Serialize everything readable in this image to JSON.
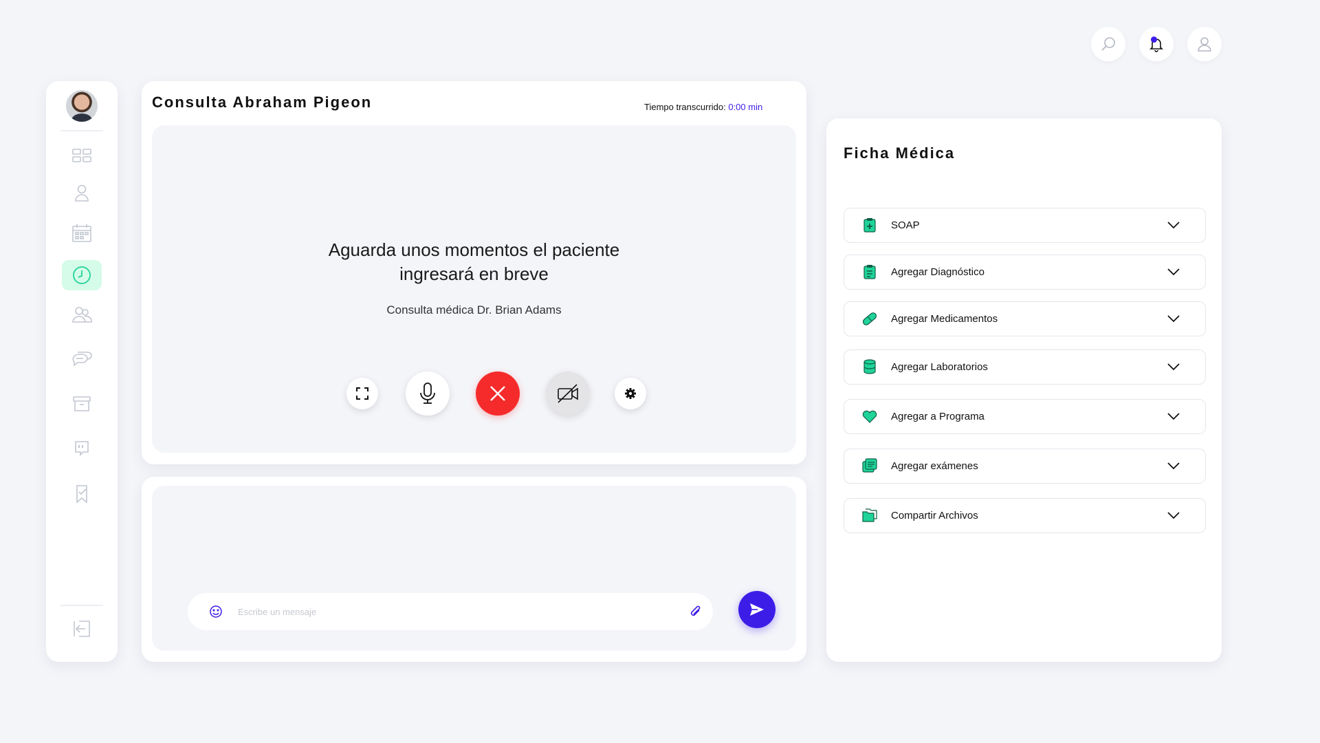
{
  "colors": {
    "accent": "#3c1de8",
    "green": "#1fd399",
    "danger": "#f52b2b",
    "background": "#f4f5f9"
  },
  "consulta": {
    "title": "Consulta Abraham Pigeon",
    "timer_label": "Tiempo transcurrido: ",
    "timer_value": "0:00 min",
    "waiting_line1": "Aguarda unos momentos el paciente",
    "waiting_line2": "ingresará en breve",
    "doctor": "Consulta médica Dr. Brian Adams"
  },
  "chat": {
    "placeholder": "Escribe un mensaje"
  },
  "ficha": {
    "title": "Ficha Médica",
    "items": [
      {
        "label": "SOAP",
        "icon": "clipboard-plus-icon"
      },
      {
        "label": "Agregar Diagnóstico",
        "icon": "clipboard-list-icon"
      },
      {
        "label": "Agregar Medicamentos",
        "icon": "pill-icon"
      },
      {
        "label": "Agregar Laboratorios",
        "icon": "database-icon"
      },
      {
        "label": "Agregar a Programa",
        "icon": "heart-icon"
      },
      {
        "label": "Agregar exámenes",
        "icon": "images-icon"
      },
      {
        "label": "Compartir Archivos",
        "icon": "folders-icon"
      }
    ]
  },
  "sidebar": {
    "items": [
      {
        "name": "dashboard",
        "icon": "grid-icon",
        "active": false
      },
      {
        "name": "profile",
        "icon": "user-icon",
        "active": false
      },
      {
        "name": "calendar",
        "icon": "calendar-icon",
        "active": false
      },
      {
        "name": "consultations",
        "icon": "clock-icon",
        "active": true
      },
      {
        "name": "patients",
        "icon": "users-icon",
        "active": false
      },
      {
        "name": "messages",
        "icon": "chat-icon",
        "active": false
      },
      {
        "name": "archive",
        "icon": "archive-icon",
        "active": false
      },
      {
        "name": "quotes",
        "icon": "quote-icon",
        "active": false
      },
      {
        "name": "tasks",
        "icon": "bookmark-check-icon",
        "active": false
      }
    ]
  }
}
